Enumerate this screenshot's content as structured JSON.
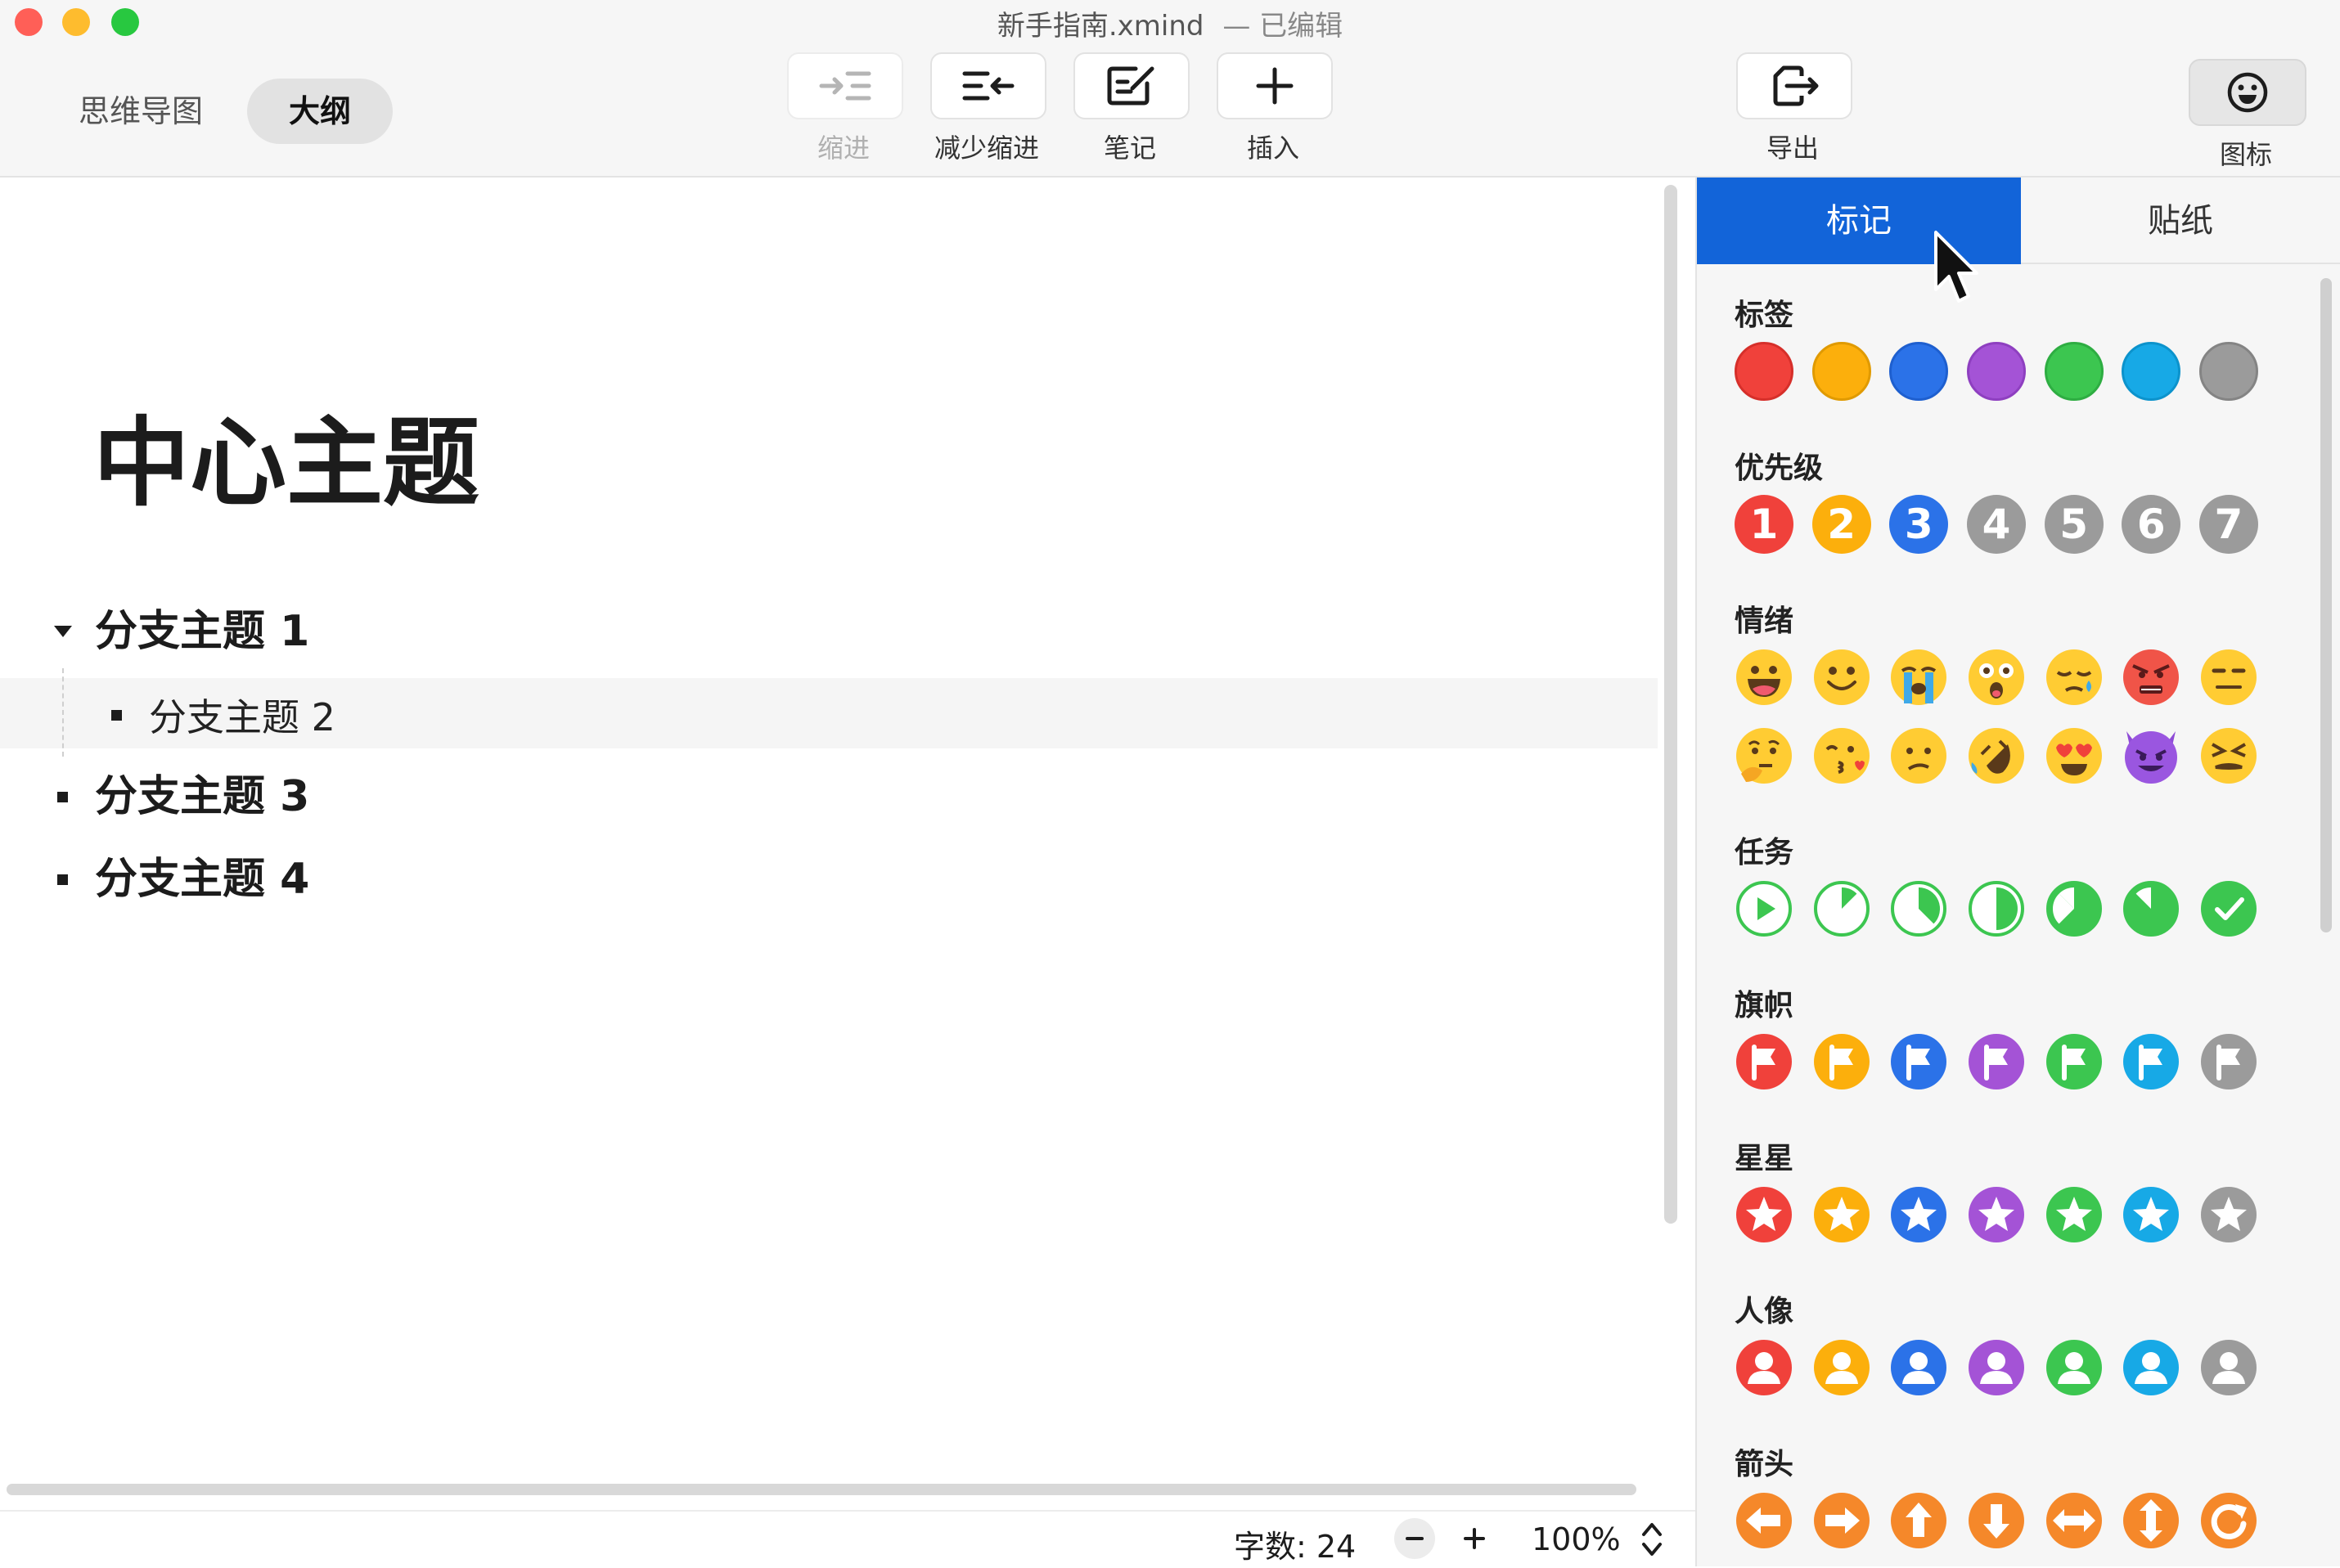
{
  "window": {
    "title": "新手指南.xmind",
    "status": "— 已编辑"
  },
  "mode_tabs": [
    "思维导图",
    "大纲"
  ],
  "toolbar": {
    "indent": "缩进",
    "outdent": "减少缩进",
    "notes": "笔记",
    "insert": "插入",
    "export": "导出",
    "icons": "图标"
  },
  "outline": {
    "central_topic": "中心主题",
    "branches": [
      {
        "label": "分支主题 1",
        "children": [
          "分支主题 2"
        ]
      },
      {
        "label": "分支主题 3"
      },
      {
        "label": "分支主题 4"
      }
    ]
  },
  "statusbar": {
    "word_count": "字数: 24",
    "zoom": "100%"
  },
  "panel": {
    "tabs": [
      "标记",
      "贴纸"
    ],
    "sections": {
      "tags": "标签",
      "priority": "优先级",
      "emotion": "情绪",
      "task": "任务",
      "flag": "旗帜",
      "star": "星星",
      "person": "人像",
      "arrow": "箭头"
    },
    "priority_numbers": [
      "1",
      "2",
      "3",
      "4",
      "5",
      "6",
      "7"
    ],
    "colors": [
      "#f0413b",
      "#fcaf0c",
      "#2b72e8",
      "#a453d6",
      "#3cc650",
      "#17a9e6",
      "#9b9b9b"
    ]
  }
}
